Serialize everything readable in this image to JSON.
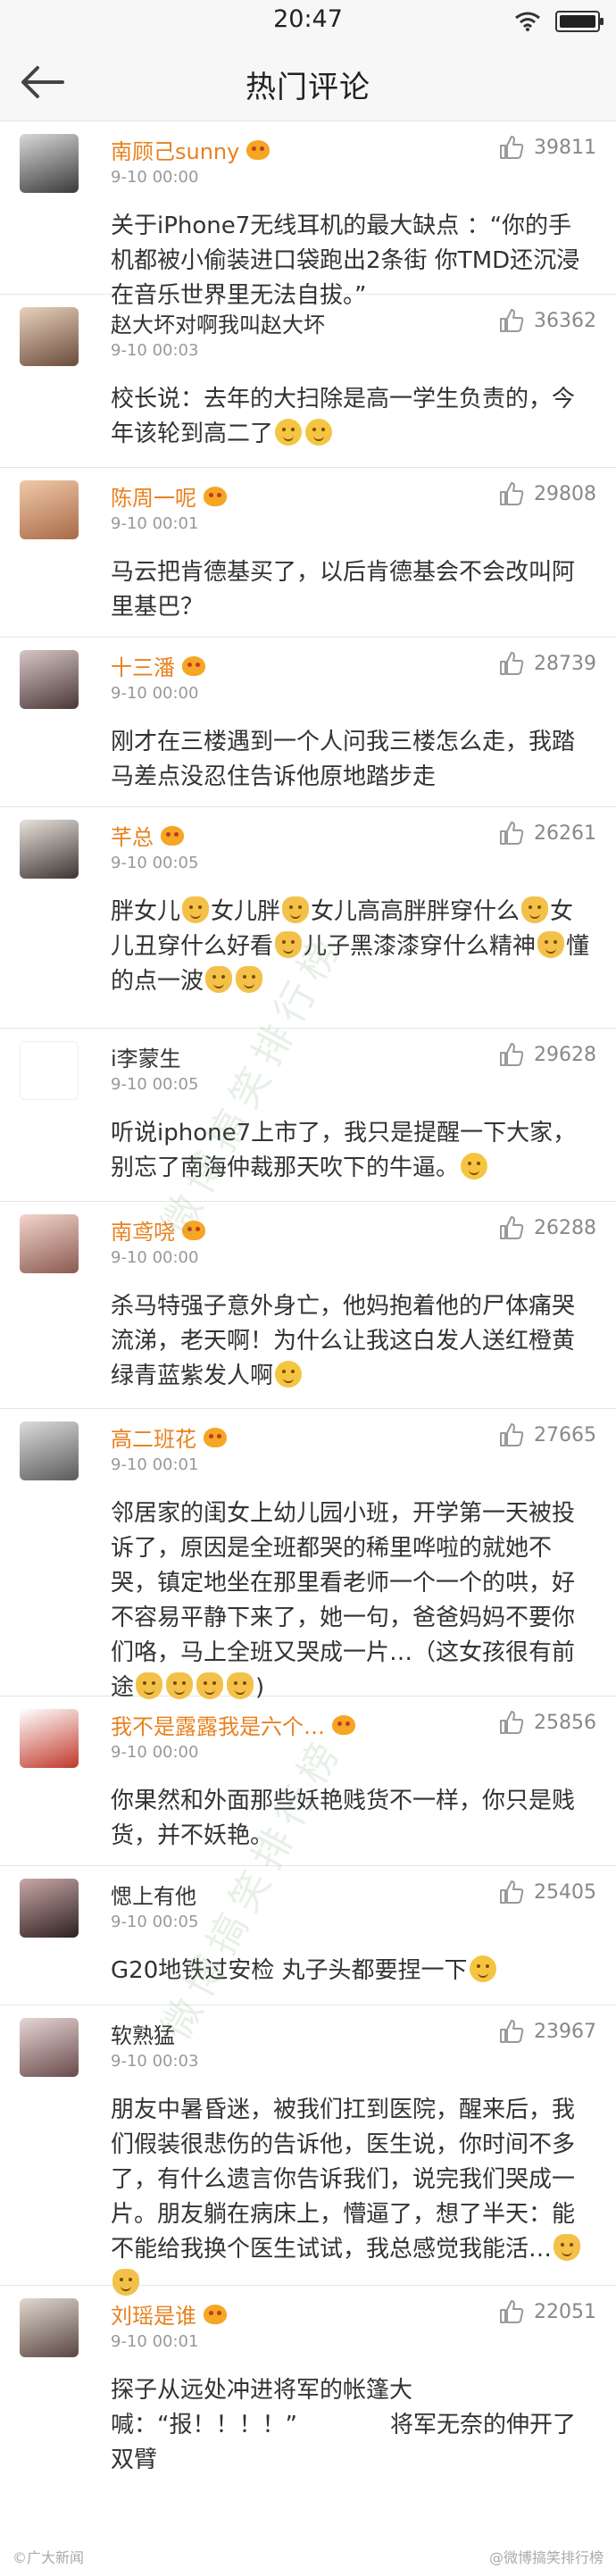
{
  "status": {
    "time": "20:47"
  },
  "nav": {
    "title": "热门评论"
  },
  "comments": [
    {
      "user": "南顾己sunny",
      "date": "9-10 00:00",
      "likes": "39811",
      "text": "关于iPhone7无线耳机的最大缺点 ：“你的手机都被小偷装进口袋跑出2条街 你TMD还沉浸在音乐世界里无法自拔。”",
      "tail": ""
    },
    {
      "user": "赵大坏对啊我叫赵大坏",
      "date": "9-10 00:03",
      "likes": "36362",
      "text": "校长说：去年的大扫除是高一学生负责的，今年该轮到高二了",
      "tail": ""
    },
    {
      "user": "陈周一呢",
      "date": "9-10 00:01",
      "likes": "29808",
      "text": "马云把肯德基买了，以后肯德基会不会改叫阿里基巴？",
      "tail": ""
    },
    {
      "user": "十三潘",
      "date": "9-10 00:00",
      "likes": "28739",
      "text": "刚才在三楼遇到一个人问我三楼怎么走，我踏马差点没忍住告诉他原地踏步走",
      "tail": ""
    },
    {
      "user": "芊总",
      "date": "9-10 00:05",
      "likes": "26261",
      "text": "胖女儿",
      "tail": ""
    },
    {
      "user": "i李蒙生",
      "date": "9-10 00:05",
      "likes": "29628",
      "text": "听说iphone7上市了，我只是提醒一下大家，别忘了南海仲裁那天吹下的牛逼。",
      "tail": ""
    },
    {
      "user": "南鸢哓",
      "date": "9-10 00:00",
      "likes": "26288",
      "text": "杀马特强子意外身亡，他妈抱着他的尸体痛哭流涕，老天啊！为什么让我这白发人送红橙黄绿青蓝紫发人啊",
      "tail": ""
    },
    {
      "user": "高二班花",
      "date": "9-10 00:01",
      "likes": "27665",
      "text": "邻居家的闺女上幼儿园小班，开学第一天被投诉了，原因是全班都哭的稀里哗啦的就她不哭，镇定地坐在那里看老师一个一个的哄，好不容易平静下来了，她一句，爸爸妈妈不要你们咯，马上全班又哭成一片…",
      "tail": "（这女孩很有前途"
    },
    {
      "user": "我不是露露我是六个…",
      "date": "9-10 00:00",
      "likes": "25856",
      "text": "你果然和外面那些妖艳贱货不一样，你只是贱货，并不妖艳。",
      "tail": ""
    },
    {
      "user": "愢上有他",
      "date": "9-10 00:05",
      "likes": "25405",
      "text": "G20地铁过安检 丸子头都要捏一下",
      "tail": ""
    },
    {
      "user": "软熟猛",
      "date": "9-10 00:03",
      "likes": "23967",
      "text": "朋友中暑昏迷，被我们扛到医院，醒来后，我们假装很悲伤的告诉他，医生说，你时间不多了，有什么遗言你告诉我们，说完我们哭成一片。朋友躺在病床上，懵逼了，想了半天：能不能给我换个医生试试，我总感觉我能活…",
      "tail": ""
    },
    {
      "user": "刘瑶是谁",
      "date": "9-10 00:01",
      "likes": "22051",
      "text": "探子从远处冲进将军的帐篷大喊：“报！！！！”　　　　将军无奈的伸开了双臂",
      "tail": ""
    }
  ],
  "comment5_parts": [
    "胖女儿",
    "女儿胖",
    "女儿高高胖胖穿什么",
    "女儿丑穿什么好看",
    "儿子黑漆漆穿什么精神",
    "懂的点一波"
  ],
  "watermarks": {
    "brand": "©广大新闻",
    "rank": "@微博搞笑排行榜",
    "diag": "微博搞笑排行榜"
  }
}
